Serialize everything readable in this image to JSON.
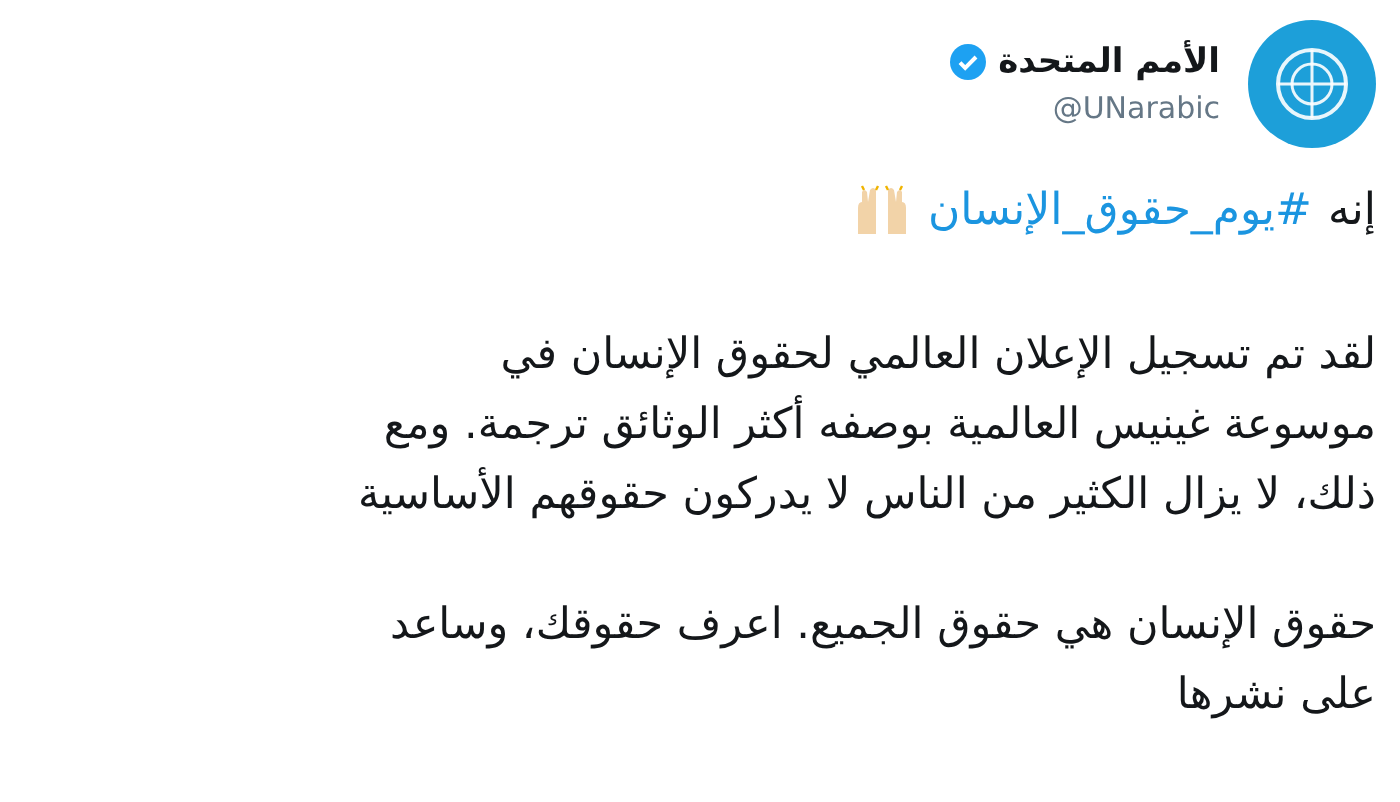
{
  "author": {
    "name": "الأمم المتحدة",
    "verified": true,
    "handle": "@UNarabic"
  },
  "headline": {
    "prefix": "إنه",
    "hashtag": "#يوم_حقوق_الإنسان"
  },
  "paragraphs": [
    "لقد تم تسجيل الإعلان العالمي لحقوق الإنسان في\nموسوعة غينيس العالمية بوصفه أكثر الوثائق ترجمة. ومع\nذلك، لا يزال الكثير من الناس لا يدركون حقوقهم الأساسية",
    "حقوق الإنسان هي حقوق الجميع. اعرف حقوقك، وساعد\nعلى نشرها"
  ]
}
